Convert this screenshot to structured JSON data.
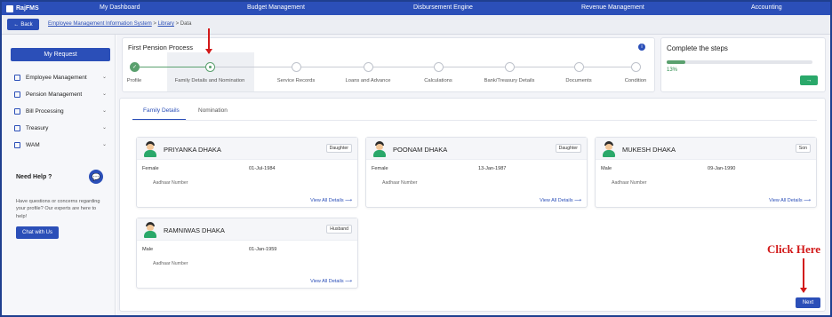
{
  "app": {
    "brand": "RajFMS"
  },
  "nav": [
    "My Dashboard",
    "Budget Management",
    "Disbursement Engine",
    "Revenue Management",
    "Accounting"
  ],
  "subbar": {
    "back_label": "Back",
    "breadcrumb": {
      "link1": "Employee Management Information System",
      "sep1": " > ",
      "link2": "Library",
      "sep2": " > ",
      "current": "Data"
    }
  },
  "sidebar": {
    "my_request": "My Request",
    "items": [
      {
        "label": "Employee Management"
      },
      {
        "label": "Pension Management"
      },
      {
        "label": "Bill Processing"
      },
      {
        "label": "Treasury"
      },
      {
        "label": "WAM"
      }
    ],
    "help_title": "Need Help ?",
    "help_text": "Have questions or concerns regarding your profile? Our experts are here to help!",
    "chat_button": "Chat with Us",
    "help_icon": "chat-bubble-icon"
  },
  "process": {
    "title": "First Pension Process",
    "steps": [
      "Profile",
      "Family Details and Nomination",
      "Service Records",
      "Loans and Advance",
      "Calculations",
      "Bank/Treasury Details",
      "Documents",
      "Condition"
    ],
    "completed_step": 0,
    "active_step": 1
  },
  "complete": {
    "title": "Complete the steps",
    "progress_text": "13%",
    "progress": 0.13,
    "arrow_label": "→"
  },
  "tabs": [
    "Family Details",
    "Nomination"
  ],
  "cards": [
    {
      "name": "PRIYANKA DHAKA",
      "relation": "Daughter",
      "gender": "Female",
      "dob": "01-Jul-1984",
      "aadhaar": "Aadhaar Number",
      "view": "View All Details"
    },
    {
      "name": "POONAM DHAKA",
      "relation": "Daughter",
      "gender": "Female",
      "dob": "13-Jan-1987",
      "aadhaar": "Aadhaar Number",
      "view": "View All Details"
    },
    {
      "name": "MUKESH DHAKA",
      "relation": "Son",
      "gender": "Male",
      "dob": "09-Jan-1990",
      "aadhaar": "Aadhaar Number",
      "view": "View All Details"
    },
    {
      "name": "RAMNIWAS DHAKA",
      "relation": "Husband",
      "gender": "Male",
      "dob": "01-Jan-1959",
      "aadhaar": "Aadhaar Number",
      "view": "View All Details"
    }
  ],
  "next_button": "Next",
  "annotation": {
    "click_here": "Click Here"
  },
  "colors": {
    "primary": "#2b4fb8",
    "success": "#5aa06e",
    "annotation": "#d21919"
  }
}
